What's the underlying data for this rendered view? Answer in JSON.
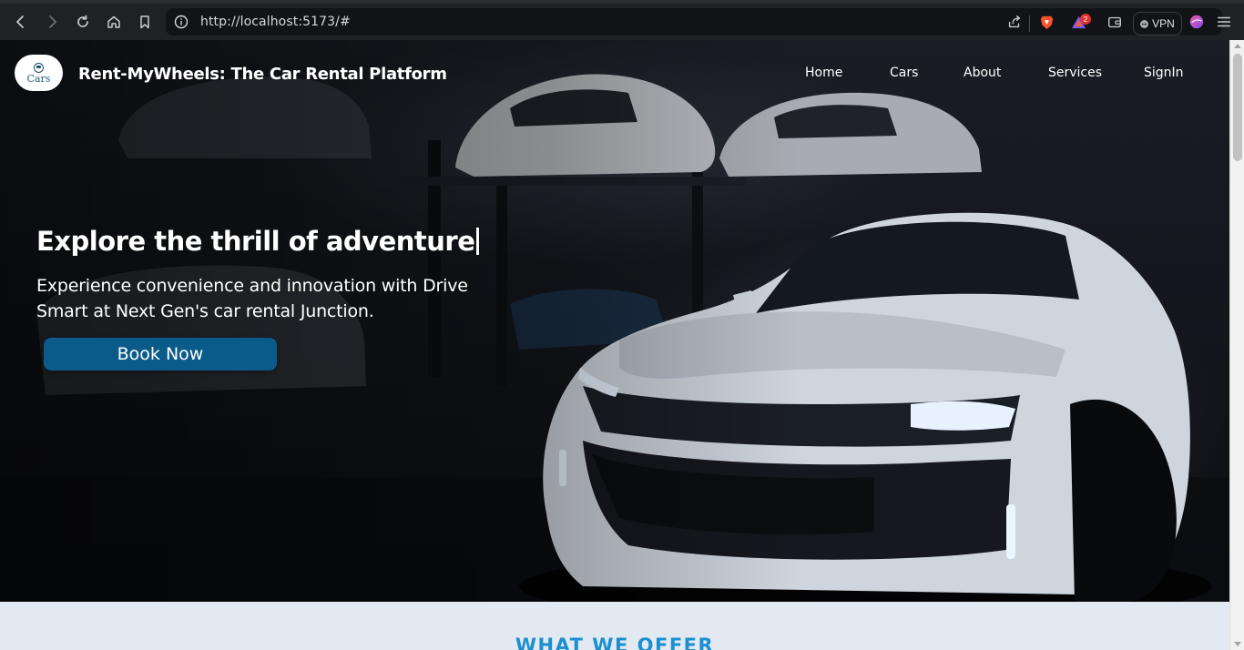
{
  "browser": {
    "url": "http://localhost:5173/#",
    "vpn_label": "VPN",
    "notification_count": "2",
    "icons": [
      "back-icon",
      "forward-icon",
      "reload-icon",
      "home-icon",
      "bookmark-icon",
      "site-info-icon",
      "share-icon",
      "brave-shields-icon",
      "brave-rewards-icon",
      "wallet-icon",
      "vpn-icon",
      "leo-icon",
      "menu-icon"
    ]
  },
  "header": {
    "logo_text": "Cars",
    "brand": "Rent-MyWheels: The Car Rental Platform",
    "nav": [
      "Home",
      "Cars",
      "About",
      "Services",
      "SignIn"
    ]
  },
  "hero": {
    "headline": "Explore the thrill of adventure",
    "subtext": "Experience convenience and innovation with Drive Smart at Next Gen's car rental Junction.",
    "cta": "Book Now"
  },
  "offer": {
    "title": "WHAT WE OFFER"
  },
  "colors": {
    "accent_button": "#0b5b8a",
    "offer_title": "#1c8fd0",
    "offer_bg": "#e3e9f0"
  }
}
